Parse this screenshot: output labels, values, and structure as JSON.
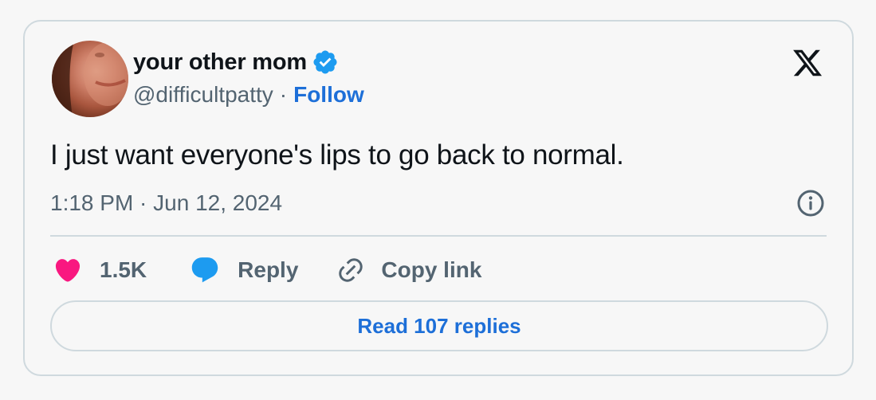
{
  "author": {
    "display_name": "your other mom",
    "handle": "@difficultpatty",
    "separator": "·",
    "follow_label": "Follow",
    "verified": true,
    "verified_color": "#1d9bf0"
  },
  "tweet": {
    "text": "I just want everyone's lips to go back to normal.",
    "timestamp": "1:18 PM · Jun 12, 2024"
  },
  "actions": {
    "like_count": "1.5K",
    "reply_label": "Reply",
    "copy_link_label": "Copy link"
  },
  "read_replies_label": "Read 107 replies",
  "colors": {
    "like": "#f91880",
    "reply": "#1d9bf0",
    "link": "#1d6fd8",
    "muted": "#536471",
    "border": "#cfd9de"
  },
  "icons": [
    "verified-badge-icon",
    "x-logo-icon",
    "info-icon",
    "heart-icon",
    "reply-bubble-icon",
    "link-icon"
  ]
}
